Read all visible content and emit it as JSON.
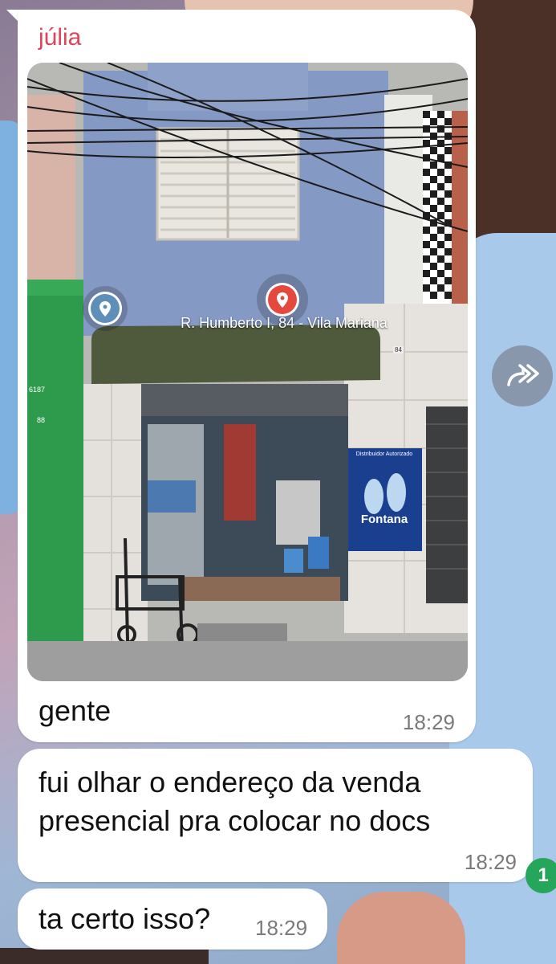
{
  "chat": {
    "messages": [
      {
        "sender": "júlia",
        "image": {
          "map_pin_label": "R. Humberto I, 84 - Vila Mariana",
          "house_number": "84",
          "left_building_numbers": [
            "6187",
            "88"
          ],
          "poster_heading": "Distribuidor Autorizado",
          "poster_brand": "Fontana"
        },
        "text": "gente",
        "time": "18:29"
      },
      {
        "text": "fui olhar o endereço da venda presencial pra colocar no docs",
        "time": "18:29"
      },
      {
        "text": "ta certo isso?",
        "time": "18:29"
      }
    ],
    "unread_count": "1"
  },
  "colors": {
    "sender_name": "#e0445a",
    "bubble": "#ffffff",
    "unread_badge": "#25a65a",
    "map_pin": "#e5483c"
  }
}
